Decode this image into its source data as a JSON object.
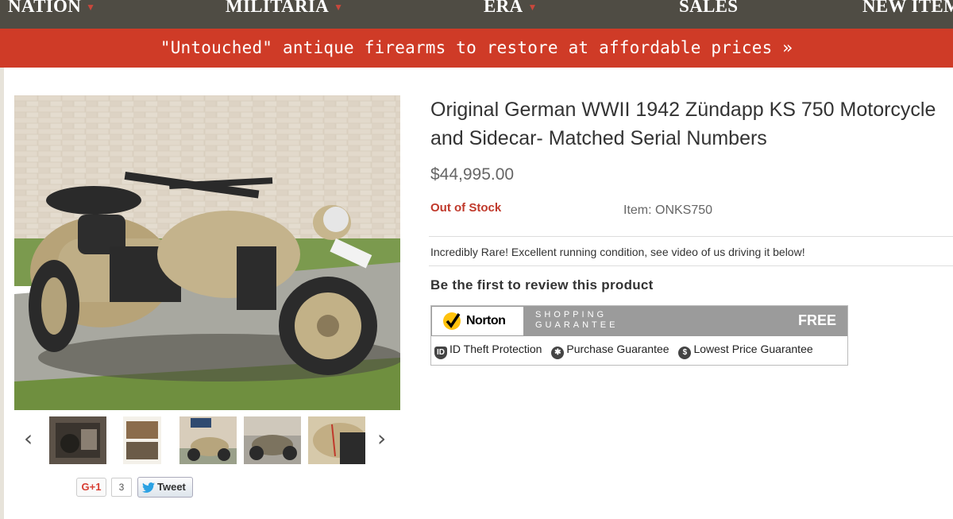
{
  "nav": {
    "items": [
      {
        "label": "NATION"
      },
      {
        "label": "MILITARIA"
      },
      {
        "label": "ERA"
      },
      {
        "label": "SALES"
      },
      {
        "label": "NEW ITEMS"
      }
    ]
  },
  "promo": {
    "text": "\"Untouched\" antique firearms to restore at affordable prices »"
  },
  "product": {
    "title": "Original German WWII 1942 Zündapp KS 750 Motorcycle and Sidecar- Matched Serial Numbers",
    "price": "$44,995.00",
    "stock_status": "Out of Stock",
    "item_number": "Item: ONKS750",
    "short_description": "Incredibly Rare! Excellent running condition, see video of us driving it below!",
    "review_prompt": "Be the first to review this product"
  },
  "gallery": {
    "prev_label": "‹",
    "next_label": "›",
    "thumb_count": 5
  },
  "social": {
    "gplus_label": "G+1",
    "gplus_count": "3",
    "tweet_label": "Tweet"
  },
  "norton": {
    "brand": "Norton",
    "shopping": "SHOPPING",
    "guarantee": "GUARANTEE",
    "free": "FREE",
    "features": [
      {
        "icon": "shield-icon",
        "label": "ID Theft Protection"
      },
      {
        "icon": "gear-icon",
        "label": "Purchase Guarantee"
      },
      {
        "icon": "dollar-icon",
        "label": "Lowest Price Guarantee"
      }
    ]
  },
  "colors": {
    "nav_bg": "#4f4c44",
    "promo_bg": "#cf3b27",
    "stock_red": "#c0392b",
    "norton_yellow": "#ffc20e"
  }
}
